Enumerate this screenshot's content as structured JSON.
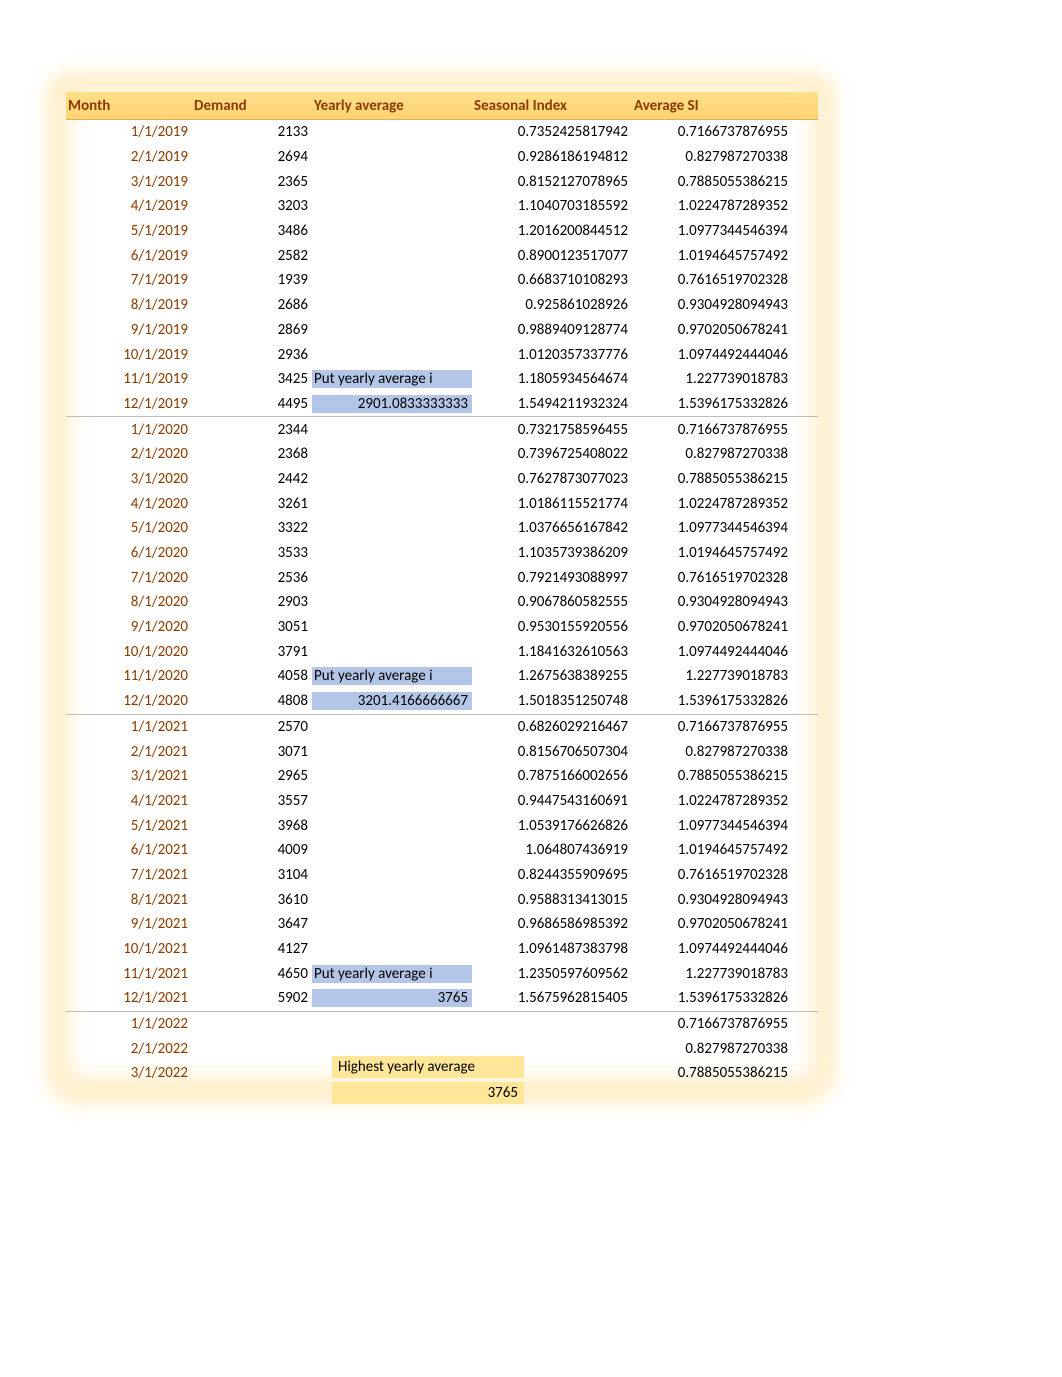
{
  "headers": {
    "month": "Month",
    "demand": "Demand",
    "yearly_average": "Yearly average",
    "seasonal_index": "Seasonal Index",
    "average_si": "Average SI"
  },
  "put_yearly_average_label": "Put yearly average i",
  "footer": {
    "label": "Highest yearly average",
    "value": "3765"
  },
  "chart_data": {
    "type": "table",
    "title": "Seasonal Index Table",
    "columns": [
      "Month",
      "Demand",
      "Yearly average",
      "Seasonal Index",
      "Average SI"
    ],
    "rows": [
      {
        "month": "1/1/2019",
        "demand": "2133",
        "yavg": "",
        "si": "0.7352425817942",
        "asi": "0.7166737876955"
      },
      {
        "month": "2/1/2019",
        "demand": "2694",
        "yavg": "",
        "si": "0.9286186194812",
        "asi": "0.827987270338"
      },
      {
        "month": "3/1/2019",
        "demand": "2365",
        "yavg": "",
        "si": "0.8152127078965",
        "asi": "0.7885055386215"
      },
      {
        "month": "4/1/2019",
        "demand": "3203",
        "yavg": "",
        "si": "1.1040703185592",
        "asi": "1.0224787289352"
      },
      {
        "month": "5/1/2019",
        "demand": "3486",
        "yavg": "",
        "si": "1.2016200844512",
        "asi": "1.0977344546394"
      },
      {
        "month": "6/1/2019",
        "demand": "2582",
        "yavg": "",
        "si": "0.8900123517077",
        "asi": "1.0194645757492"
      },
      {
        "month": "7/1/2019",
        "demand": "1939",
        "yavg": "",
        "si": "0.6683710108293",
        "asi": "0.7616519702328"
      },
      {
        "month": "8/1/2019",
        "demand": "2686",
        "yavg": "",
        "si": "0.925861028926",
        "asi": "0.9304928094943"
      },
      {
        "month": "9/1/2019",
        "demand": "2869",
        "yavg": "",
        "si": "0.9889409128774",
        "asi": "0.9702050678241"
      },
      {
        "month": "10/1/2019",
        "demand": "2936",
        "yavg": "",
        "si": "1.0120357337776",
        "asi": "1.0974492444046"
      },
      {
        "month": "11/1/2019",
        "demand": "3425",
        "yavg": "PUT",
        "si": "1.1805934564674",
        "asi": "1.227739018783"
      },
      {
        "month": "12/1/2019",
        "demand": "4495",
        "yavg": "2901.0833333333",
        "si": "1.5494211932324",
        "asi": "1.5396175332826",
        "sep": true
      },
      {
        "month": "1/1/2020",
        "demand": "2344",
        "yavg": "",
        "si": "0.7321758596455",
        "asi": "0.7166737876955"
      },
      {
        "month": "2/1/2020",
        "demand": "2368",
        "yavg": "",
        "si": "0.7396725408022",
        "asi": "0.827987270338"
      },
      {
        "month": "3/1/2020",
        "demand": "2442",
        "yavg": "",
        "si": "0.7627873077023",
        "asi": "0.7885055386215"
      },
      {
        "month": "4/1/2020",
        "demand": "3261",
        "yavg": "",
        "si": "1.0186115521774",
        "asi": "1.0224787289352"
      },
      {
        "month": "5/1/2020",
        "demand": "3322",
        "yavg": "",
        "si": "1.0376656167842",
        "asi": "1.0977344546394"
      },
      {
        "month": "6/1/2020",
        "demand": "3533",
        "yavg": "",
        "si": "1.1035739386209",
        "asi": "1.0194645757492"
      },
      {
        "month": "7/1/2020",
        "demand": "2536",
        "yavg": "",
        "si": "0.7921493088997",
        "asi": "0.7616519702328"
      },
      {
        "month": "8/1/2020",
        "demand": "2903",
        "yavg": "",
        "si": "0.9067860582555",
        "asi": "0.9304928094943"
      },
      {
        "month": "9/1/2020",
        "demand": "3051",
        "yavg": "",
        "si": "0.9530155920556",
        "asi": "0.9702050678241"
      },
      {
        "month": "10/1/2020",
        "demand": "3791",
        "yavg": "",
        "si": "1.1841632610563",
        "asi": "1.0974492444046"
      },
      {
        "month": "11/1/2020",
        "demand": "4058",
        "yavg": "PUT",
        "si": "1.2675638389255",
        "asi": "1.227739018783"
      },
      {
        "month": "12/1/2020",
        "demand": "4808",
        "yavg": "3201.4166666667",
        "si": "1.5018351250748",
        "asi": "1.5396175332826",
        "sep": true
      },
      {
        "month": "1/1/2021",
        "demand": "2570",
        "yavg": "",
        "si": "0.6826029216467",
        "asi": "0.7166737876955"
      },
      {
        "month": "2/1/2021",
        "demand": "3071",
        "yavg": "",
        "si": "0.8156706507304",
        "asi": "0.827987270338"
      },
      {
        "month": "3/1/2021",
        "demand": "2965",
        "yavg": "",
        "si": "0.7875166002656",
        "asi": "0.7885055386215"
      },
      {
        "month": "4/1/2021",
        "demand": "3557",
        "yavg": "",
        "si": "0.9447543160691",
        "asi": "1.0224787289352"
      },
      {
        "month": "5/1/2021",
        "demand": "3968",
        "yavg": "",
        "si": "1.0539176626826",
        "asi": "1.0977344546394"
      },
      {
        "month": "6/1/2021",
        "demand": "4009",
        "yavg": "",
        "si": "1.064807436919",
        "asi": "1.0194645757492"
      },
      {
        "month": "7/1/2021",
        "demand": "3104",
        "yavg": "",
        "si": "0.8244355909695",
        "asi": "0.7616519702328"
      },
      {
        "month": "8/1/2021",
        "demand": "3610",
        "yavg": "",
        "si": "0.9588313413015",
        "asi": "0.9304928094943"
      },
      {
        "month": "9/1/2021",
        "demand": "3647",
        "yavg": "",
        "si": "0.9686586985392",
        "asi": "0.9702050678241"
      },
      {
        "month": "10/1/2021",
        "demand": "4127",
        "yavg": "",
        "si": "1.0961487383798",
        "asi": "1.0974492444046"
      },
      {
        "month": "11/1/2021",
        "demand": "4650",
        "yavg": "PUT",
        "si": "1.2350597609562",
        "asi": "1.227739018783"
      },
      {
        "month": "12/1/2021",
        "demand": "5902",
        "yavg": "3765",
        "si": "1.5675962815405",
        "asi": "1.5396175332826",
        "sep": true,
        "yavg_right": true
      },
      {
        "month": "1/1/2022",
        "demand": "",
        "yavg": "",
        "si": "",
        "asi": "0.7166737876955"
      },
      {
        "month": "2/1/2022",
        "demand": "",
        "yavg": "",
        "si": "",
        "asi": "0.827987270338"
      },
      {
        "month": "3/1/2022",
        "demand": "",
        "yavg": "",
        "si": "",
        "asi": "0.7885055386215"
      }
    ]
  }
}
